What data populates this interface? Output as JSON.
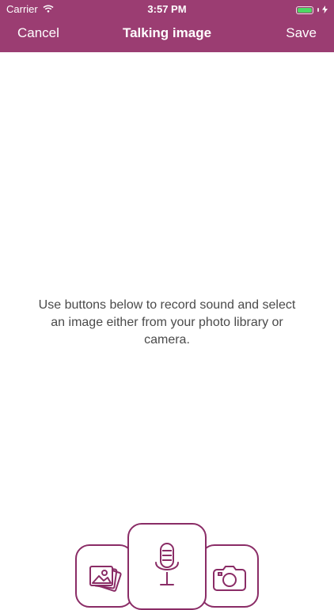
{
  "status_bar": {
    "carrier": "Carrier",
    "time": "3:57 PM",
    "battery_icon": "battery-icon",
    "wifi_icon": "wifi-icon",
    "charging_icon": "charging-bolt-icon"
  },
  "nav": {
    "cancel_label": "Cancel",
    "title": "Talking image",
    "save_label": "Save"
  },
  "instructions": "Use buttons below to record sound and select an image either from your photo library or camera.",
  "actions": [
    {
      "icon": "photo-library-icon"
    },
    {
      "icon": "microphone-icon"
    },
    {
      "icon": "camera-icon"
    }
  ],
  "colors": {
    "accent": "#9b3d72",
    "border": "#8a2c66",
    "battery": "#4cd964"
  }
}
